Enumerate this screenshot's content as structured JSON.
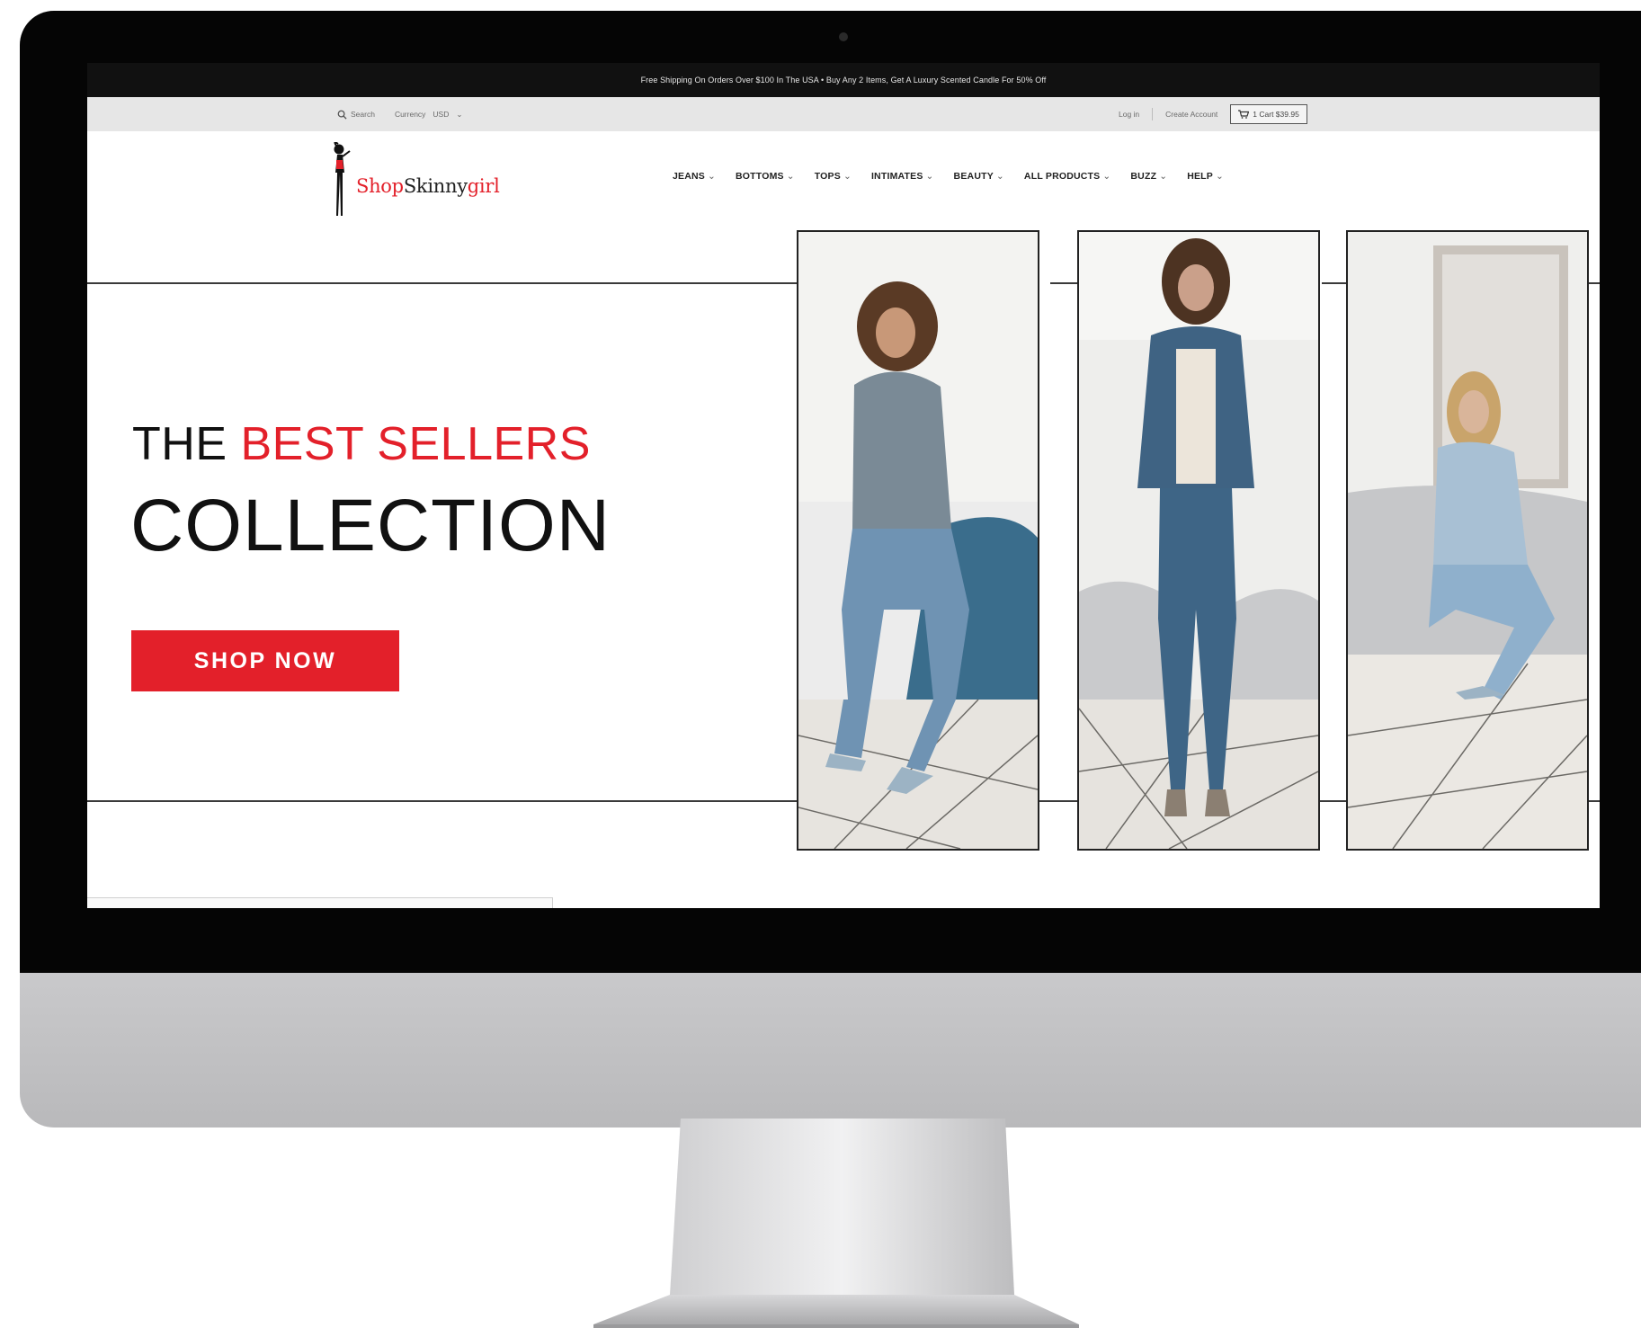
{
  "announcement": {
    "text": "Free Shipping On Orders Over $100 In The USA • Buy Any 2 Items, Get A Luxury Scented Candle For 50% Off"
  },
  "utility_bar": {
    "search_label": "Search",
    "currency_label": "Currency",
    "currency_value": "USD",
    "login_label": "Log in",
    "create_account_label": "Create Account",
    "cart_label": "1 Cart $39.95"
  },
  "logo": {
    "part1": "Shop",
    "part2": "Skinny",
    "part3": "girl"
  },
  "nav": {
    "items": [
      {
        "label": "JEANS"
      },
      {
        "label": "BOTTOMS"
      },
      {
        "label": "TOPS"
      },
      {
        "label": "INTIMATES"
      },
      {
        "label": "BEAUTY"
      },
      {
        "label": "ALL PRODUCTS"
      },
      {
        "label": "BUZZ"
      },
      {
        "label": "HELP"
      }
    ],
    "caret": "⌄"
  },
  "hero": {
    "title_prefix": "THE ",
    "title_highlight": "BEST SELLERS",
    "title_line2": "COLLECTION",
    "cta_label": "SHOP NOW"
  },
  "colors": {
    "accent": "#e3202a",
    "announcement_bg": "#111111",
    "utility_bg": "#e6e6e6"
  },
  "icons": {
    "search": "search-icon",
    "cart": "cart-icon",
    "dropdown": "chevron-down-icon"
  }
}
